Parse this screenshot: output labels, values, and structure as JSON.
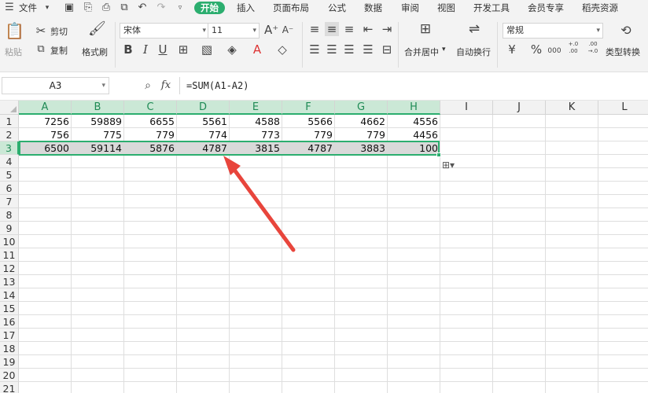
{
  "menu": {
    "file_label": "文件",
    "tabs": [
      "开始",
      "插入",
      "页面布局",
      "公式",
      "数据",
      "审阅",
      "视图",
      "开发工具",
      "会员专享",
      "稻壳资源"
    ],
    "active_tab": "开始"
  },
  "ribbon": {
    "paste_label": "粘贴",
    "cut_label": "剪切",
    "copy_label": "复制",
    "format_painter_label": "格式刷",
    "font_name": "宋体",
    "font_size": "11",
    "merge_center_label": "合并居中",
    "wrap_text_label": "自动换行",
    "number_format": "常规",
    "type_convert_label": "类型转换",
    "currency_symbol": "¥",
    "percent_symbol": "%",
    "thousands_symbol": "000",
    "inc_decimal_label": "+.0 .00",
    "dec_decimal_label": ".00 →.0"
  },
  "formula_bar": {
    "name_box": "A3",
    "fx_label": "fx",
    "formula": "=SUM(A1-A2)"
  },
  "grid": {
    "columns": [
      "A",
      "B",
      "C",
      "D",
      "E",
      "F",
      "G",
      "H",
      "I",
      "J",
      "K",
      "L"
    ],
    "rows": [
      "1",
      "2",
      "3",
      "4",
      "5",
      "6",
      "7",
      "8",
      "9",
      "10",
      "11",
      "12",
      "13",
      "14",
      "15",
      "16",
      "17",
      "18",
      "19",
      "20",
      "21"
    ],
    "data": [
      [
        "7256",
        "59889",
        "6655",
        "5561",
        "4588",
        "5566",
        "4662",
        "4556"
      ],
      [
        "756",
        "775",
        "779",
        "774",
        "773",
        "779",
        "779",
        "4456"
      ],
      [
        "6500",
        "59114",
        "5876",
        "4787",
        "3815",
        "4787",
        "3883",
        "100"
      ]
    ],
    "selected_row": 3,
    "selected_range": "A3:H3"
  },
  "colors": {
    "accent": "#2cae6f",
    "annotation_arrow": "#e8453c",
    "selection_fill": "#d9d9d9"
  }
}
